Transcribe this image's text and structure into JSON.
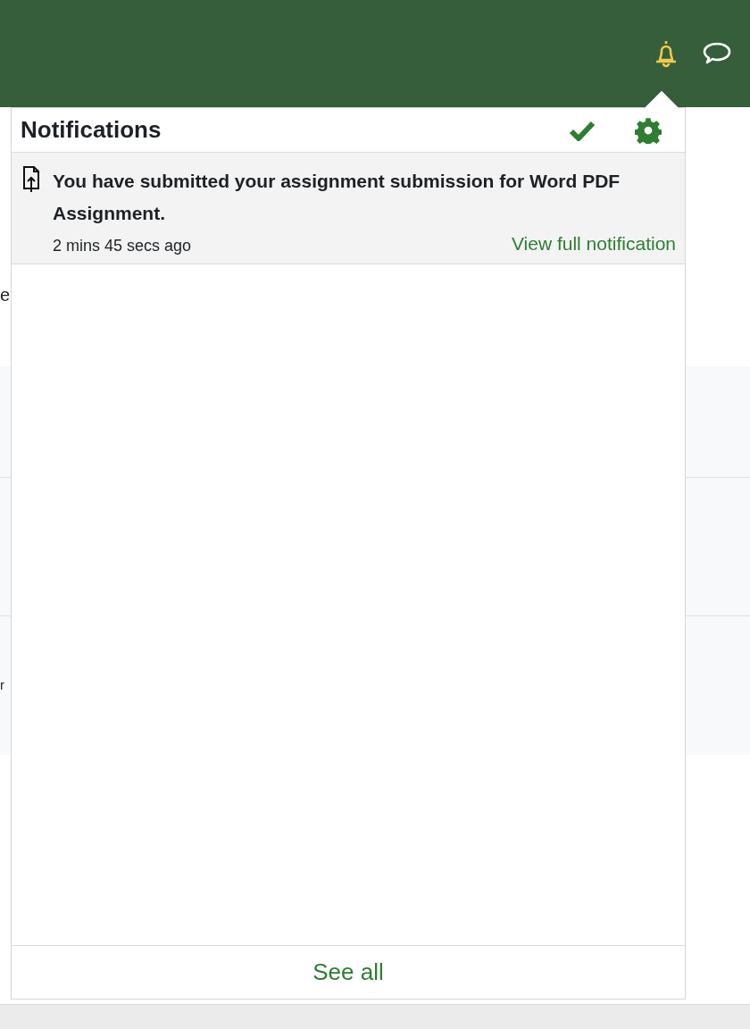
{
  "background": {
    "heading_fragment": "e",
    "row_fragment": "r"
  },
  "notifications": {
    "title": "Notifications",
    "items": [
      {
        "message": "You have submitted your assignment submission for Word PDF Assignment.",
        "time": "2 mins 45 secs ago",
        "link": "View full notification"
      }
    ],
    "see_all": "See all"
  }
}
